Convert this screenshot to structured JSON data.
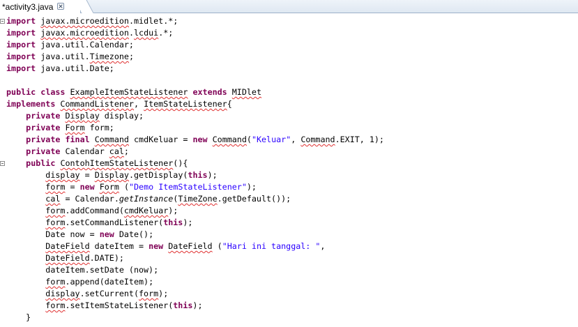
{
  "tab": {
    "label": "*activity3.java",
    "close_icon": "close-icon"
  },
  "colors": {
    "keyword": "#7f0055",
    "string": "#2a00ff",
    "squiggle": "#e03030"
  },
  "fold_markers": [
    {
      "line": 1,
      "icon": "fold-collapse-icon"
    },
    {
      "line": 13,
      "icon": "fold-collapse-icon"
    }
  ],
  "code_lines": [
    [
      {
        "t": "import",
        "k": "kw"
      },
      {
        "t": " "
      },
      {
        "t": "javax.microedition",
        "k": "sq"
      },
      {
        "t": ".midlet.*;"
      }
    ],
    [
      {
        "t": "import",
        "k": "kw"
      },
      {
        "t": " "
      },
      {
        "t": "javax.microedition",
        "k": "sq"
      },
      {
        "t": "."
      },
      {
        "t": "lcdui",
        "k": "sq"
      },
      {
        "t": ".*;"
      }
    ],
    [
      {
        "t": "import",
        "k": "kw"
      },
      {
        "t": " java.util.Calendar;"
      }
    ],
    [
      {
        "t": "import",
        "k": "kw"
      },
      {
        "t": " java.util."
      },
      {
        "t": "Timezone",
        "k": "sq"
      },
      {
        "t": ";"
      }
    ],
    [
      {
        "t": "import",
        "k": "kw"
      },
      {
        "t": " java.util.Date;"
      }
    ],
    [],
    [
      {
        "t": "public",
        "k": "kw"
      },
      {
        "t": " "
      },
      {
        "t": "class",
        "k": "kw"
      },
      {
        "t": " "
      },
      {
        "t": "ExampleItemStateListener",
        "k": "sq"
      },
      {
        "t": " "
      },
      {
        "t": "extends",
        "k": "kw"
      },
      {
        "t": " "
      },
      {
        "t": "MIDlet",
        "k": "sq"
      }
    ],
    [
      {
        "t": "implements",
        "k": "kw"
      },
      {
        "t": " "
      },
      {
        "t": "CommandListener",
        "k": "sq"
      },
      {
        "t": ", "
      },
      {
        "t": "ItemStateListener",
        "k": "sq"
      },
      {
        "t": "{"
      }
    ],
    [
      {
        "t": "    "
      },
      {
        "t": "private",
        "k": "kw"
      },
      {
        "t": " "
      },
      {
        "t": "Display",
        "k": "sq"
      },
      {
        "t": " display;"
      }
    ],
    [
      {
        "t": "    "
      },
      {
        "t": "private",
        "k": "kw"
      },
      {
        "t": " "
      },
      {
        "t": "Form",
        "k": "sq"
      },
      {
        "t": " form;"
      }
    ],
    [
      {
        "t": "    "
      },
      {
        "t": "private",
        "k": "kw"
      },
      {
        "t": " "
      },
      {
        "t": "final",
        "k": "kw"
      },
      {
        "t": " "
      },
      {
        "t": "Command",
        "k": "sq"
      },
      {
        "t": " cmdKeluar = "
      },
      {
        "t": "new",
        "k": "kw"
      },
      {
        "t": " "
      },
      {
        "t": "Command",
        "k": "sq"
      },
      {
        "t": "("
      },
      {
        "t": "\"Keluar\"",
        "k": "str"
      },
      {
        "t": ", "
      },
      {
        "t": "Command",
        "k": "sq"
      },
      {
        "t": ".EXIT, 1);"
      }
    ],
    [
      {
        "t": "    "
      },
      {
        "t": "private",
        "k": "kw"
      },
      {
        "t": " Calendar "
      },
      {
        "t": "cal",
        "k": "sq"
      },
      {
        "t": ";"
      }
    ],
    [
      {
        "t": "    "
      },
      {
        "t": "public",
        "k": "kw"
      },
      {
        "t": " "
      },
      {
        "t": "ContohItemStateListener",
        "k": "sq"
      },
      {
        "t": "(){"
      }
    ],
    [
      {
        "t": "        "
      },
      {
        "t": "display",
        "k": "sq"
      },
      {
        "t": " = "
      },
      {
        "t": "Display",
        "k": "sq"
      },
      {
        "t": ".getDisplay("
      },
      {
        "t": "this",
        "k": "kw"
      },
      {
        "t": ");"
      }
    ],
    [
      {
        "t": "        "
      },
      {
        "t": "form",
        "k": "sq"
      },
      {
        "t": " = "
      },
      {
        "t": "new",
        "k": "kw"
      },
      {
        "t": " "
      },
      {
        "t": "Form",
        "k": "sq"
      },
      {
        "t": " ("
      },
      {
        "t": "\"Demo ItemStateListener\"",
        "k": "str"
      },
      {
        "t": ");"
      }
    ],
    [
      {
        "t": "        "
      },
      {
        "t": "cal",
        "k": "sq"
      },
      {
        "t": " = Calendar."
      },
      {
        "t": "getInstance",
        "k": "it"
      },
      {
        "t": "("
      },
      {
        "t": "TimeZone",
        "k": "sq"
      },
      {
        "t": ".getDefault());"
      }
    ],
    [
      {
        "t": "        "
      },
      {
        "t": "form",
        "k": "sq"
      },
      {
        "t": ".addCommand("
      },
      {
        "t": "cmdKeluar",
        "k": "sq"
      },
      {
        "t": ");"
      }
    ],
    [
      {
        "t": "        "
      },
      {
        "t": "form",
        "k": "sq"
      },
      {
        "t": ".setCommandListener("
      },
      {
        "t": "this",
        "k": "kw"
      },
      {
        "t": ");"
      }
    ],
    [
      {
        "t": "        Date now = "
      },
      {
        "t": "new",
        "k": "kw"
      },
      {
        "t": " Date();"
      }
    ],
    [
      {
        "t": "        "
      },
      {
        "t": "DateField",
        "k": "sq"
      },
      {
        "t": " dateItem = "
      },
      {
        "t": "new",
        "k": "kw"
      },
      {
        "t": " "
      },
      {
        "t": "DateField",
        "k": "sq"
      },
      {
        "t": " ("
      },
      {
        "t": "\"Hari ini tanggal: \"",
        "k": "str"
      },
      {
        "t": ","
      }
    ],
    [
      {
        "t": "        "
      },
      {
        "t": "DateField",
        "k": "sq"
      },
      {
        "t": ".DATE);"
      }
    ],
    [
      {
        "t": "        dateItem.setDate (now);"
      }
    ],
    [
      {
        "t": "        "
      },
      {
        "t": "form",
        "k": "sq"
      },
      {
        "t": ".append(dateItem);"
      }
    ],
    [
      {
        "t": "        "
      },
      {
        "t": "display",
        "k": "sq"
      },
      {
        "t": ".setCurrent("
      },
      {
        "t": "form",
        "k": "sq"
      },
      {
        "t": ");"
      }
    ],
    [
      {
        "t": "        "
      },
      {
        "t": "form",
        "k": "sq"
      },
      {
        "t": ".setItemStateListener("
      },
      {
        "t": "this",
        "k": "kw"
      },
      {
        "t": ");"
      }
    ],
    [
      {
        "t": "    }"
      }
    ]
  ]
}
